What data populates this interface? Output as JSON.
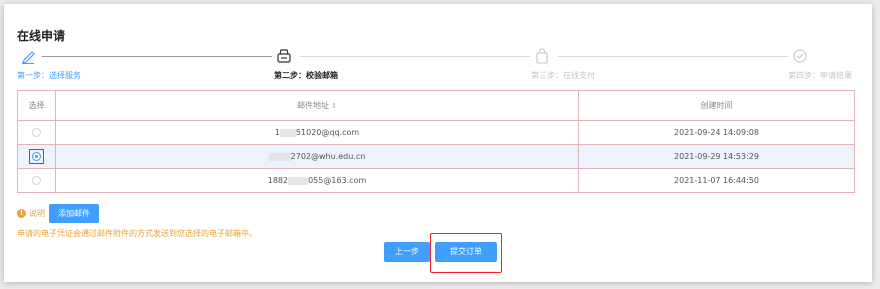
{
  "page_title": "在线申请",
  "steps": [
    {
      "label": "第一步：选择服务",
      "state": "done",
      "icon": "pencil-icon"
    },
    {
      "label": "第二步：校验邮箱",
      "state": "active",
      "icon": "mail-icon"
    },
    {
      "label": "第三步：在线支付",
      "state": "pending",
      "icon": "shopping-bag-icon"
    },
    {
      "label": "第四步：申请结果",
      "state": "pending",
      "icon": "check-circle-icon"
    }
  ],
  "table": {
    "headers": {
      "select": "选择",
      "email": "邮件地址",
      "time": "创建时间"
    },
    "rows": [
      {
        "email_prefix": "1",
        "email_suffix": "51020@qq.com",
        "time": "2021-09-24 14:09:08",
        "selected": false
      },
      {
        "email_prefix": "",
        "email_suffix": "2702@whu.edu.cn",
        "time": "2021-09-29 14:53:29",
        "selected": true
      },
      {
        "email_prefix": "1882",
        "email_suffix": "055@163.com",
        "time": "2021-11-07 16:44:50",
        "selected": false
      }
    ]
  },
  "note": {
    "label": "说明",
    "add_button": "添加邮件",
    "text": "申请的电子凭证会通过邮件附件的方式发送到您选择的电子邮箱中。"
  },
  "actions": {
    "prev": "上一步",
    "submit": "提交订单"
  },
  "colors": {
    "accent": "#409eff",
    "warning": "#e6a23c",
    "highlight": "#ee2233"
  }
}
